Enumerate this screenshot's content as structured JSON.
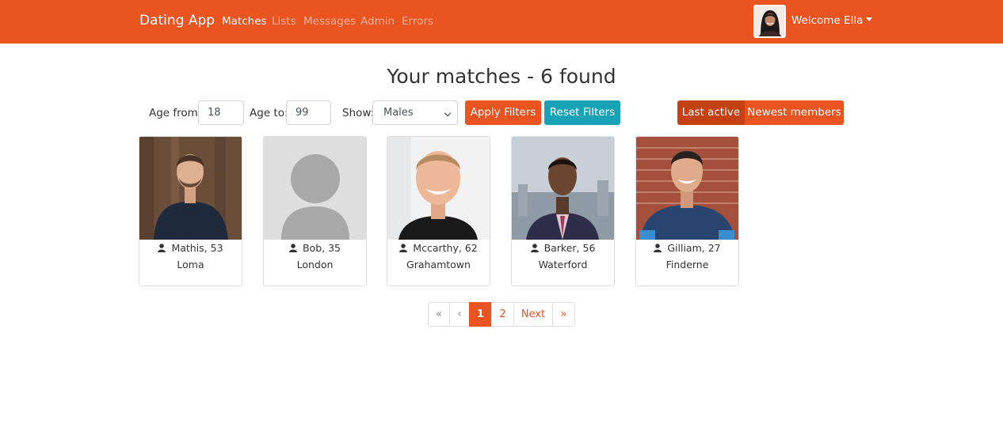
{
  "navbar": {
    "brand": "Dating App",
    "links": [
      "Matches",
      "Lists",
      "Messages",
      "Admin",
      "Errors"
    ],
    "active_link": "Matches",
    "welcome": "Welcome Ella",
    "color": "#e95420"
  },
  "page": {
    "title": "Your matches - 6 found"
  },
  "filters": {
    "age_from_label": "Age from:",
    "age_from_value": "18",
    "age_to_label": "Age to:",
    "age_to_value": "99",
    "show_label": "Show:",
    "show_value": "Males",
    "apply_label": "Apply Filters",
    "reset_label": "Reset Filters",
    "sort_last_active": "Last active",
    "sort_newest": "Newest members",
    "active_sort": "Last active"
  },
  "members": [
    {
      "name_age": "Mathis, 53",
      "city": "Loma"
    },
    {
      "name_age": "Bob, 35",
      "city": "London"
    },
    {
      "name_age": "Mccarthy, 62",
      "city": "Grahamtown"
    },
    {
      "name_age": "Barker, 56",
      "city": "Waterford"
    },
    {
      "name_age": "Gilliam, 27",
      "city": "Finderne"
    }
  ],
  "pagination": {
    "first": "«",
    "prev": "‹",
    "pages": [
      "1",
      "2"
    ],
    "current": "1",
    "next": "Next",
    "last": "»"
  },
  "colors": {
    "primary": "#e95420",
    "primary_dark": "#c34113",
    "info": "#17a2b8"
  }
}
